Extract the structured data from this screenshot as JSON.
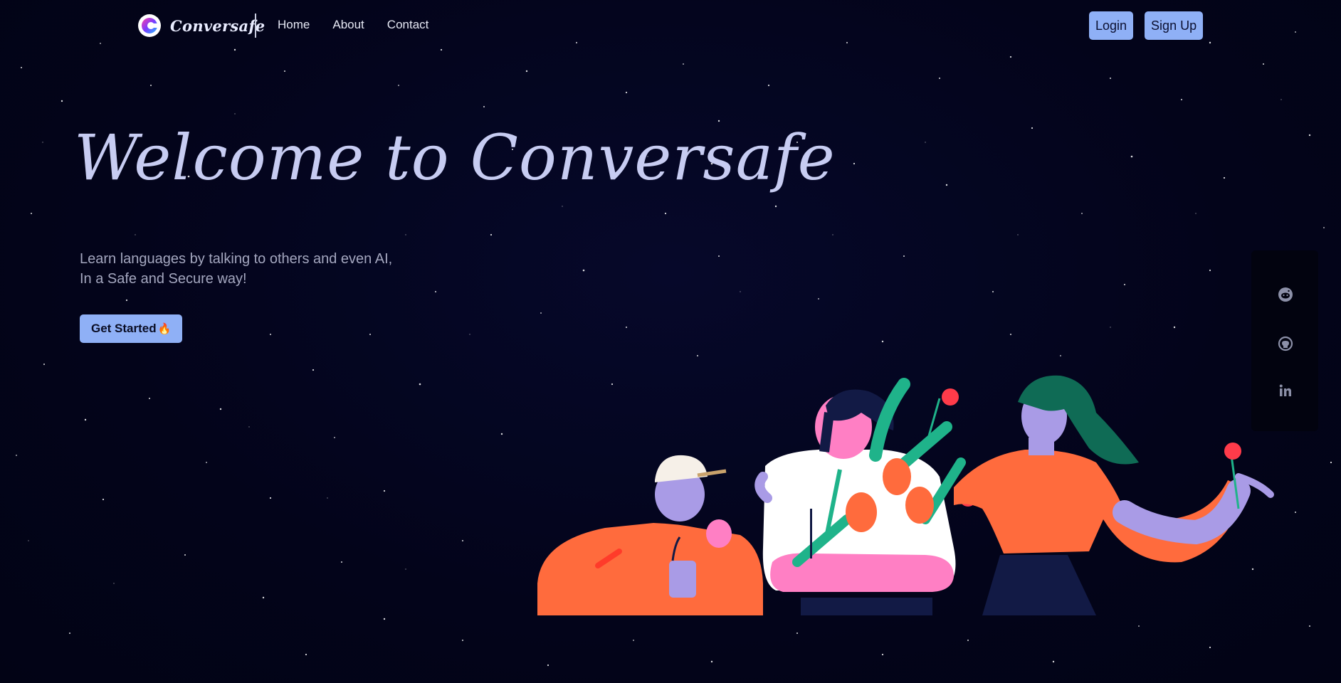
{
  "brand": {
    "name": "Conversafe"
  },
  "nav": {
    "links": [
      "Home",
      "About",
      "Contact"
    ]
  },
  "auth": {
    "login_label": "Login",
    "signup_label": "Sign Up"
  },
  "hero": {
    "title": "Welcome to Conversafe",
    "subtitle_line1": "Learn languages by talking to others and even AI,",
    "subtitle_line2": "In a Safe and Secure way!",
    "cta_label": "Get Started",
    "cta_emoji": "🔥"
  },
  "social": {
    "icons": [
      "reddit-icon",
      "github-icon",
      "linkedin-icon"
    ]
  },
  "colors": {
    "background": "#03041a",
    "accent": "#8fb0f6",
    "title": "#c7ccf2",
    "illustration_orange": "#ff6b3d",
    "illustration_lavender": "#a99be6",
    "illustration_pink": "#ff7fc4",
    "illustration_green": "#1fb38a",
    "illustration_navy": "#121a45"
  }
}
